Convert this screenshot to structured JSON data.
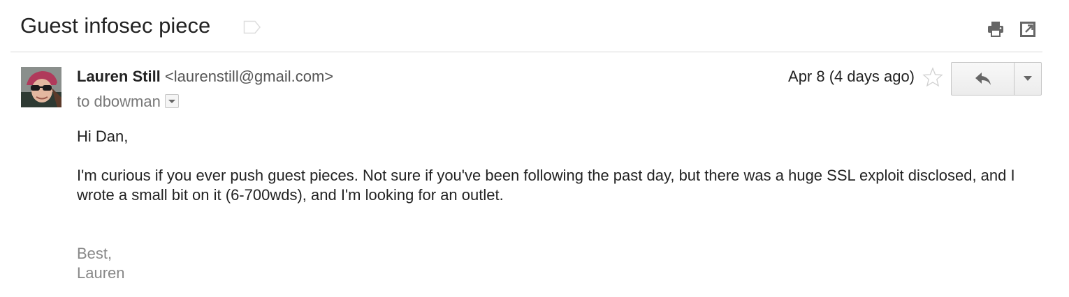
{
  "thread": {
    "subject": "Guest infosec piece",
    "label_icon": "label-tag-icon",
    "actions": {
      "print_icon": "print-icon",
      "popout_icon": "new-window-icon"
    }
  },
  "message": {
    "sender_name": "Lauren Still",
    "sender_email": "<laurenstill@gmail.com>",
    "to_line": "to dbowman",
    "date": "Apr 8 (4 days ago)",
    "starred": false,
    "reply_icon": "reply-arrow-icon",
    "more_icon": "chevron-down-icon",
    "body": {
      "greeting": "Hi Dan,",
      "paragraph": "I'm curious if you ever push guest pieces.  Not sure if you've been following the past day, but there was a huge SSL exploit disclosed, and I wrote a small bit on it (6-700wds), and I'm looking for an outlet."
    },
    "signature": {
      "closing": "Best,",
      "name": "Lauren"
    }
  },
  "colors": {
    "text": "#222222",
    "muted": "#777777",
    "signature": "#888888",
    "divider": "#d8d8d8"
  }
}
